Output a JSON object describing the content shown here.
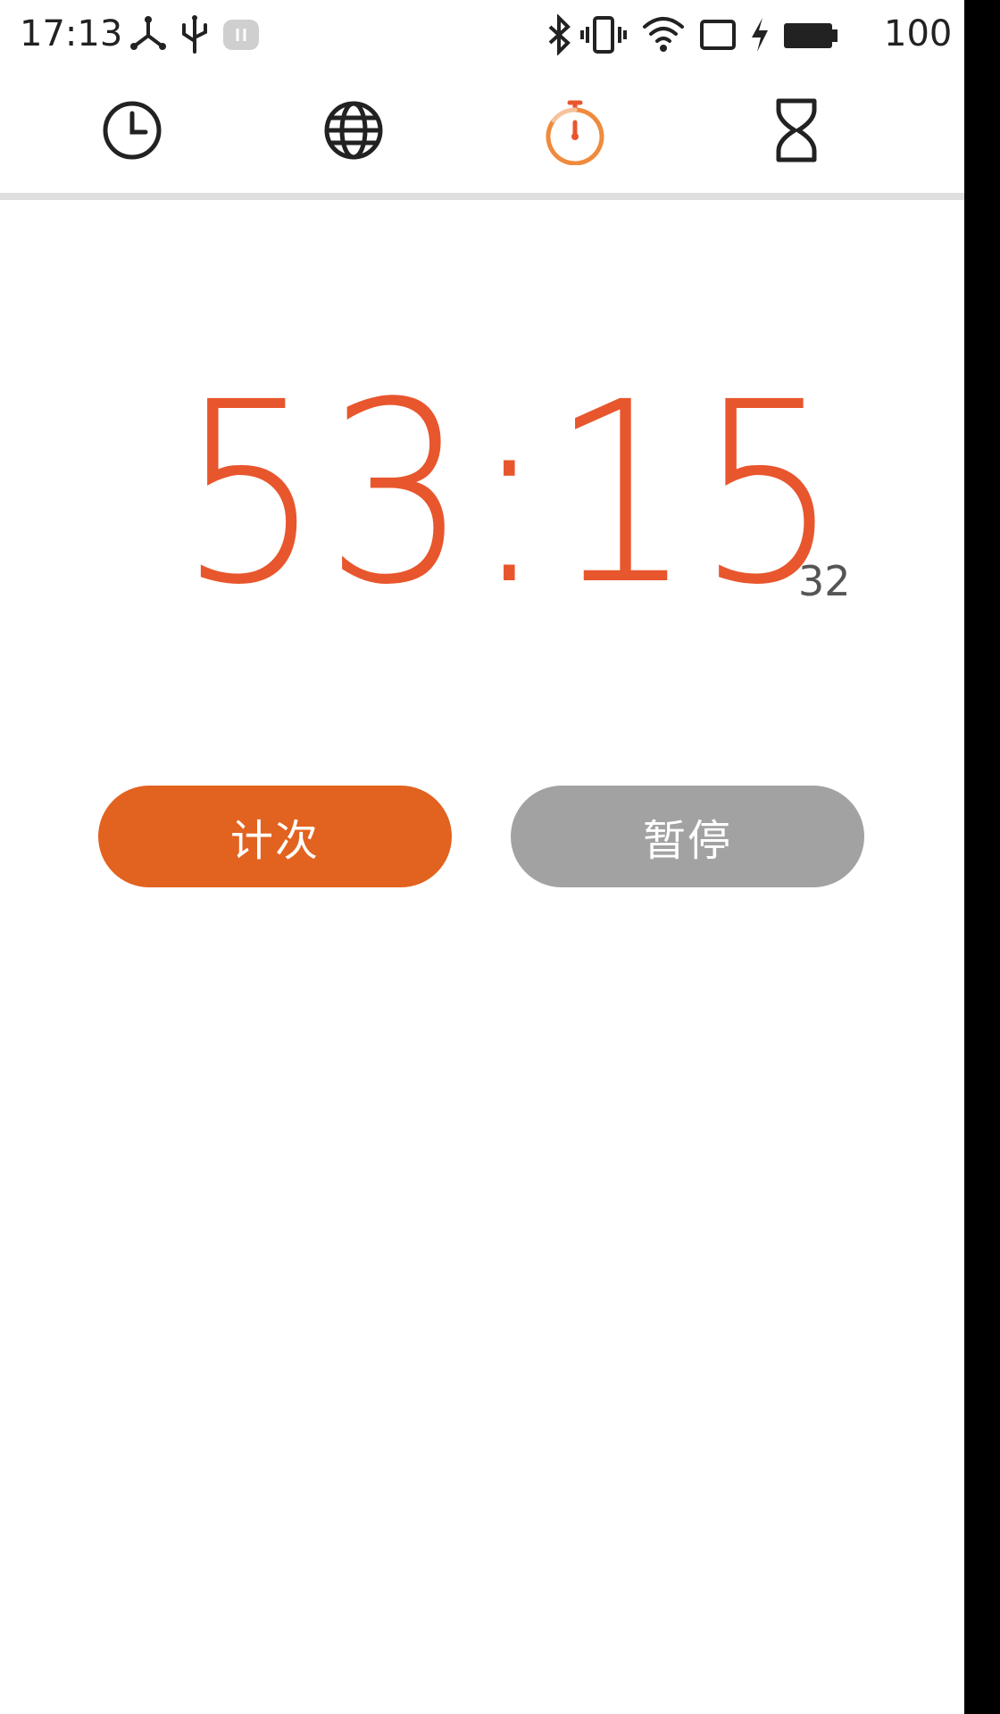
{
  "status_bar": {
    "time": "17:13",
    "left_icons": [
      "share-icon",
      "usb-icon",
      "notification-badge-icon"
    ],
    "right_icons": [
      "bluetooth-icon",
      "vibrate-icon",
      "wifi-icon",
      "screen-icon",
      "charging-icon",
      "battery-icon"
    ],
    "battery_level": "100"
  },
  "tabs": [
    {
      "name": "clock",
      "icon": "clock-icon",
      "active": false
    },
    {
      "name": "world-clock",
      "icon": "globe-icon",
      "active": false
    },
    {
      "name": "stopwatch",
      "icon": "stopwatch-icon",
      "active": true
    },
    {
      "name": "timer",
      "icon": "hourglass-icon",
      "active": false
    }
  ],
  "stopwatch": {
    "main": "53:15",
    "fraction": "32"
  },
  "buttons": {
    "lap_label": "计次",
    "pause_label": "暂停"
  },
  "colors": {
    "accent": "#e8562d",
    "lap_button": "#e2621f",
    "pause_button": "#a2a2a2"
  }
}
